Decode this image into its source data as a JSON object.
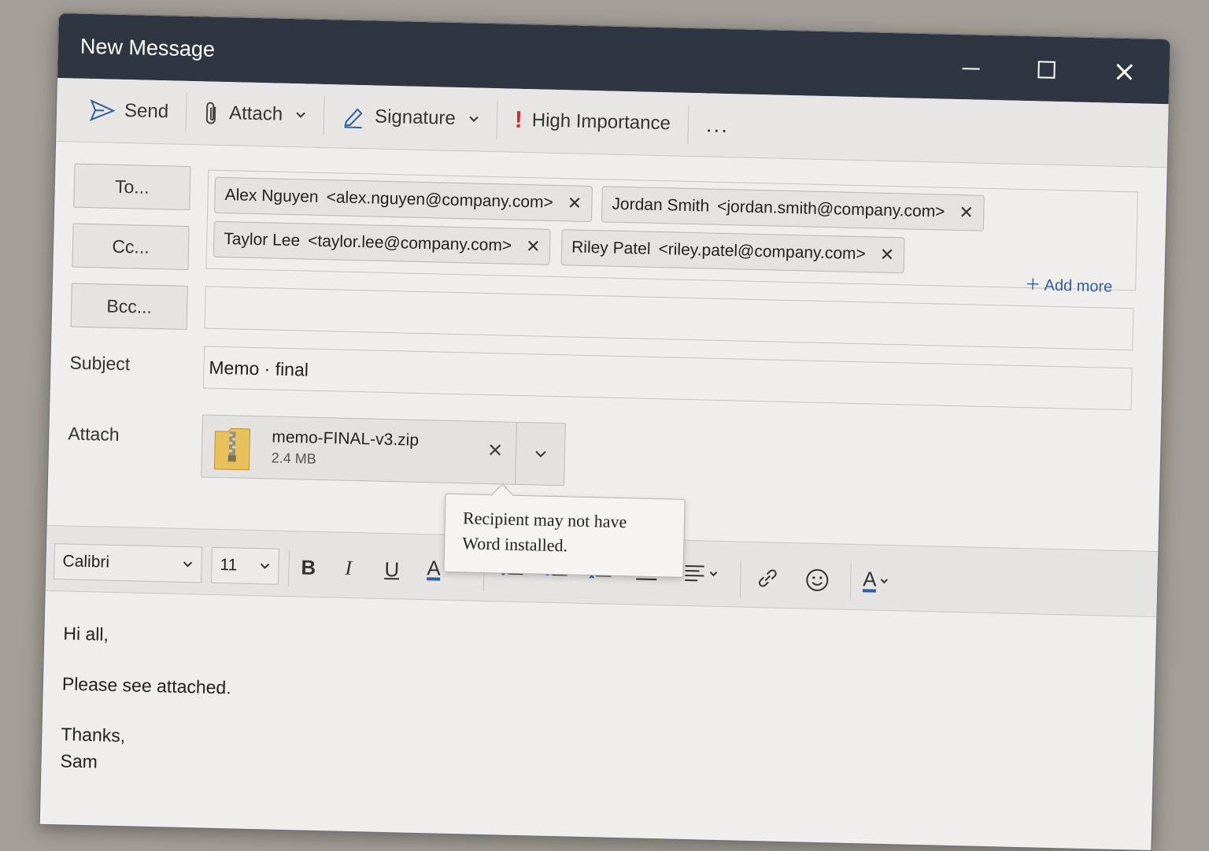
{
  "window": {
    "title": "New Message"
  },
  "toolbar": {
    "send": "Send",
    "attach": "Attach",
    "signature": "Signature",
    "importance_icon": "!",
    "importance": "High Importance",
    "more": "..."
  },
  "fields": {
    "to_label": "To...",
    "cc_label": "Cc...",
    "bcc_label": "Bcc...",
    "subject_label": "Subject",
    "subject_value": "Memo · final",
    "attach_label": "Attach",
    "add_more": "Add more"
  },
  "recipients": {
    "to": [
      {
        "name": "Alex Nguyen",
        "email": "<alex.nguyen@company.com>"
      },
      {
        "name": "Jordan Smith",
        "email": "<jordan.smith@company.com>"
      }
    ],
    "cc": [
      {
        "name": "Taylor Lee",
        "email": "<taylor.lee@company.com>"
      },
      {
        "name": "Riley Patel",
        "email": "<riley.patel@company.com>"
      }
    ]
  },
  "attachment": {
    "name": "memo-FINAL-v3.zip",
    "size": "2.4 MB"
  },
  "tooltip": {
    "line1": "Recipient may not have",
    "line2": "Word installed."
  },
  "format": {
    "font": "Calibri",
    "size": "11",
    "bold": "B",
    "italic": "I",
    "underline": "U",
    "font_color": "A",
    "text_color": "A"
  },
  "body": {
    "greeting": "Hi all,",
    "line": "Please see attached.",
    "closing": "Thanks,",
    "signature": "Sam"
  },
  "colors": {
    "titlebar": "#2d3641",
    "accent": "#2f5f9a",
    "importance": "#d12d24"
  },
  "icons": [
    "send-icon",
    "paperclip-icon",
    "pen-icon",
    "exclamation-icon",
    "zip-file-icon",
    "link-icon",
    "emoji-icon"
  ]
}
